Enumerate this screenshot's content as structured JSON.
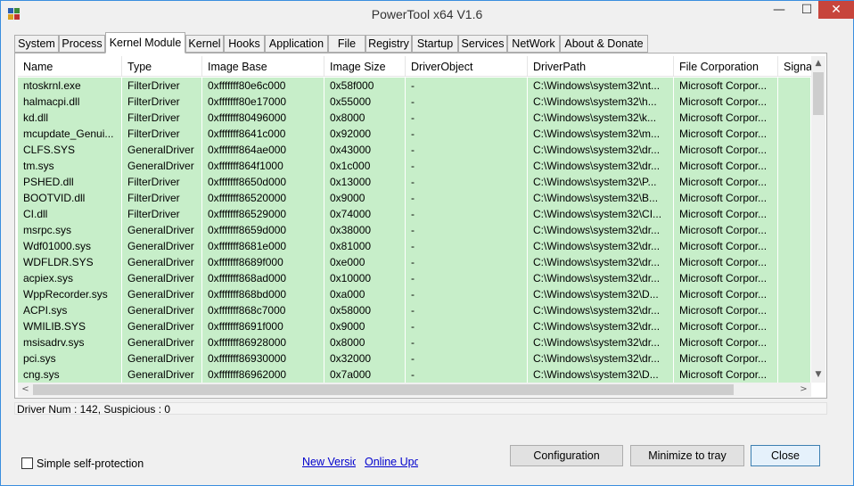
{
  "window": {
    "title": "PowerTool x64 V1.6",
    "controls": {
      "minimize": "—",
      "maximize": "☐",
      "close": "✕"
    }
  },
  "tabs": [
    {
      "label": "System"
    },
    {
      "label": "Process"
    },
    {
      "label": "Kernel Module",
      "active": true
    },
    {
      "label": "Kernel"
    },
    {
      "label": "Hooks"
    },
    {
      "label": "Application"
    },
    {
      "label": "File"
    },
    {
      "label": "Registry"
    },
    {
      "label": "Startup"
    },
    {
      "label": "Services"
    },
    {
      "label": "NetWork"
    },
    {
      "label": "About & Donate"
    }
  ],
  "table": {
    "columns": [
      "Name",
      "Type",
      "Image Base",
      "Image Size",
      "DriverObject",
      "DriverPath",
      "File Corporation",
      "Signat"
    ],
    "rows": [
      [
        "ntoskrnl.exe",
        "FilterDriver",
        "0xfffffff80e6c000",
        "0x58f000",
        "-",
        "C:\\Windows\\system32\\nt...",
        "Microsoft Corpor..."
      ],
      [
        "halmacpi.dll",
        "FilterDriver",
        "0xfffffff80e17000",
        "0x55000",
        "-",
        "C:\\Windows\\system32\\h...",
        "Microsoft Corpor..."
      ],
      [
        "kd.dll",
        "FilterDriver",
        "0xfffffff80496000",
        "0x8000",
        "-",
        "C:\\Windows\\system32\\k...",
        "Microsoft Corpor..."
      ],
      [
        "mcupdate_Genui...",
        "FilterDriver",
        "0xfffffff8641c000",
        "0x92000",
        "-",
        "C:\\Windows\\system32\\m...",
        "Microsoft Corpor..."
      ],
      [
        "CLFS.SYS",
        "GeneralDriver",
        "0xfffffff864ae000",
        "0x43000",
        "-",
        "C:\\Windows\\system32\\dr...",
        "Microsoft Corpor..."
      ],
      [
        "tm.sys",
        "GeneralDriver",
        "0xfffffff864f1000",
        "0x1c000",
        "-",
        "C:\\Windows\\system32\\dr...",
        "Microsoft Corpor..."
      ],
      [
        "PSHED.dll",
        "FilterDriver",
        "0xfffffff8650d000",
        "0x13000",
        "-",
        "C:\\Windows\\system32\\P...",
        "Microsoft Corpor..."
      ],
      [
        "BOOTVID.dll",
        "FilterDriver",
        "0xfffffff86520000",
        "0x9000",
        "-",
        "C:\\Windows\\system32\\B...",
        "Microsoft Corpor..."
      ],
      [
        "CI.dll",
        "FilterDriver",
        "0xfffffff86529000",
        "0x74000",
        "-",
        "C:\\Windows\\system32\\CI...",
        "Microsoft Corpor..."
      ],
      [
        "msrpc.sys",
        "GeneralDriver",
        "0xfffffff8659d000",
        "0x38000",
        "-",
        "C:\\Windows\\system32\\dr...",
        "Microsoft Corpor..."
      ],
      [
        "Wdf01000.sys",
        "GeneralDriver",
        "0xfffffff8681e000",
        "0x81000",
        "-",
        "C:\\Windows\\system32\\dr...",
        "Microsoft Corpor..."
      ],
      [
        "WDFLDR.SYS",
        "GeneralDriver",
        "0xfffffff8689f000",
        "0xe000",
        "-",
        "C:\\Windows\\system32\\dr...",
        "Microsoft Corpor..."
      ],
      [
        "acpiex.sys",
        "GeneralDriver",
        "0xfffffff868ad000",
        "0x10000",
        "-",
        "C:\\Windows\\system32\\dr...",
        "Microsoft Corpor..."
      ],
      [
        "WppRecorder.sys",
        "GeneralDriver",
        "0xfffffff868bd000",
        "0xa000",
        "-",
        "C:\\Windows\\system32\\D...",
        "Microsoft Corpor..."
      ],
      [
        "ACPI.sys",
        "GeneralDriver",
        "0xfffffff868c7000",
        "0x58000",
        "-",
        "C:\\Windows\\system32\\dr...",
        "Microsoft Corpor..."
      ],
      [
        "WMILIB.SYS",
        "GeneralDriver",
        "0xfffffff8691f000",
        "0x9000",
        "-",
        "C:\\Windows\\system32\\dr...",
        "Microsoft Corpor..."
      ],
      [
        "msisadrv.sys",
        "GeneralDriver",
        "0xfffffff86928000",
        "0x8000",
        "-",
        "C:\\Windows\\system32\\dr...",
        "Microsoft Corpor..."
      ],
      [
        "pci.sys",
        "GeneralDriver",
        "0xfffffff86930000",
        "0x32000",
        "-",
        "C:\\Windows\\system32\\dr...",
        "Microsoft Corpor..."
      ],
      [
        "cng.sys",
        "GeneralDriver",
        "0xfffffff86962000",
        "0x7a000",
        "-",
        "C:\\Windows\\system32\\D...",
        "Microsoft Corpor..."
      ]
    ]
  },
  "scrollbars": {
    "up": "▲",
    "down": "▼",
    "left": "<",
    "right": ">"
  },
  "status": {
    "text": "Driver Num : 142, Suspicious : 0"
  },
  "footer": {
    "self_protection_label": "Simple self-protection",
    "self_protection_checked": false,
    "link_new": "New Version",
    "link_online": "Online Update",
    "configuration_label": "Configuration",
    "minimize_tray_label": "Minimize to tray",
    "close_label": "Close"
  },
  "colors": {
    "row_highlight": "#c7eec9",
    "link": "#0000cc",
    "close_button": "#c7453c"
  }
}
